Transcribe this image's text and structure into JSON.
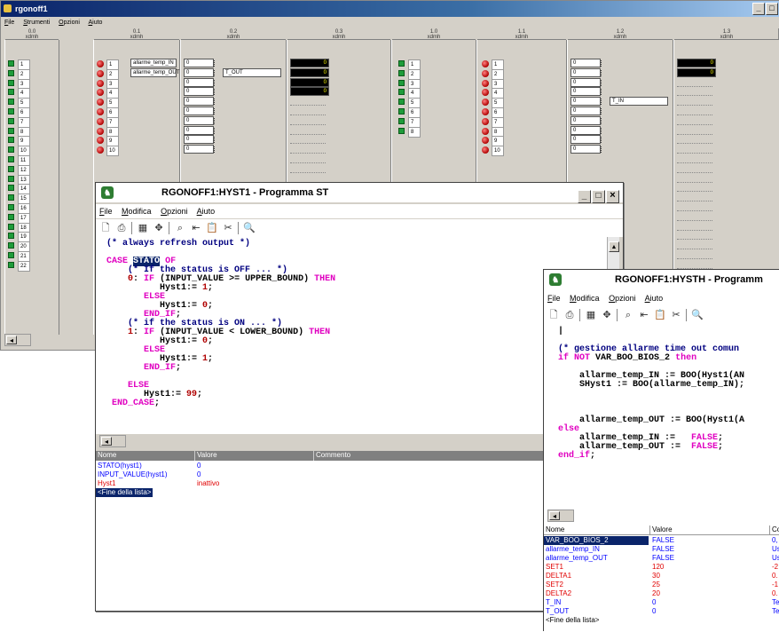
{
  "main": {
    "title": "rgonoff1",
    "menu": [
      {
        "label": "File",
        "u": "F",
        "rest": "ile"
      },
      {
        "label": "Strumenti",
        "u": "S",
        "rest": "trumenti"
      },
      {
        "label": "Opzioni",
        "u": "O",
        "rest": "pzioni"
      },
      {
        "label": "Aiuto",
        "u": "A",
        "rest": "iuto"
      }
    ],
    "modules": [
      {
        "num": "0.0",
        "kind": "xdmh"
      },
      {
        "num": "0.1",
        "kind": "xdmh"
      },
      {
        "num": "0.2",
        "kind": "xdmh"
      },
      {
        "num": "0.3",
        "kind": "xdmh"
      },
      {
        "num": "1.0",
        "kind": "xdmh"
      },
      {
        "num": "1.1",
        "kind": "xdmh"
      },
      {
        "num": "1.2",
        "kind": "xdmh"
      },
      {
        "num": "1.3",
        "kind": "xdmh"
      }
    ],
    "ch22": [
      "1",
      "2",
      "3",
      "4",
      "5",
      "6",
      "7",
      "8",
      "9",
      "10",
      "11",
      "12",
      "13",
      "14",
      "15",
      "16",
      "17",
      "18",
      "19",
      "20",
      "21",
      "22"
    ],
    "ch10": [
      "1",
      "2",
      "3",
      "4",
      "5",
      "6",
      "7",
      "8",
      "9",
      "10"
    ],
    "ch8": [
      "1",
      "2",
      "3",
      "4",
      "5",
      "6",
      "7",
      "8"
    ],
    "names_01": [
      "allarme_temp_IN",
      "allarme_temp_OUT"
    ],
    "vals_02": [
      "0",
      "0",
      "0",
      "0",
      "0",
      "0",
      "0",
      "0",
      "0",
      "0"
    ],
    "label_tout": "T_OUT",
    "vals_03": [
      "0",
      "0",
      "0",
      "0"
    ],
    "vals_12": [
      "0",
      "0",
      "0",
      "0",
      "0",
      "0",
      "0",
      "0",
      "0",
      "0"
    ],
    "label_tin": "T_IN",
    "vals_13": [
      "0",
      "0"
    ],
    "controls": {
      "minimize": "_",
      "maximize": "□"
    }
  },
  "hyst1": {
    "title": "RGONOFF1:HYST1 - Programma ST",
    "menu": [
      {
        "u": "F",
        "rest": "ile"
      },
      {
        "u": "M",
        "rest": "odifica"
      },
      {
        "u": "O",
        "rest": "pzioni"
      },
      {
        "u": "A",
        "rest": "iuto"
      }
    ],
    "controls": {
      "minimize": "_",
      "maximize": "□",
      "close": "×"
    },
    "code_line0": "(* always refresh output *)",
    "grid_headers": [
      "Nome",
      "Valore",
      "Commento"
    ],
    "grid_rows": [
      {
        "name": "STATO(hyst1)",
        "value": "0",
        "color": "blue"
      },
      {
        "name": "INPUT_VALUE(hyst1)",
        "value": "0",
        "color": "blue"
      },
      {
        "name": "Hyst1",
        "value": "inattivo",
        "color": "red"
      }
    ],
    "end_of_list": "<Fine della lista>"
  },
  "hysth": {
    "title": "RGONOFF1:HYSTH - Programm",
    "menu": [
      {
        "u": "F",
        "rest": "ile"
      },
      {
        "u": "M",
        "rest": "odifica"
      },
      {
        "u": "O",
        "rest": "pzioni"
      },
      {
        "u": "A",
        "rest": "iuto"
      }
    ],
    "grid_headers": [
      "Nome",
      "Valore",
      "Co"
    ],
    "grid_rows": [
      {
        "name": "VAR_BOO_BIOS_2",
        "value": "FALSE",
        "comment": "0,",
        "color": "blue",
        "selected": true
      },
      {
        "name": "allarme_temp_IN",
        "value": "FALSE",
        "comment": "Us",
        "color": "blue"
      },
      {
        "name": "allarme_temp_OUT",
        "value": "FALSE",
        "comment": "Us",
        "color": "blue"
      },
      {
        "name": "SET1",
        "value": "120",
        "comment": "-2",
        "color": "red"
      },
      {
        "name": "DELTA1",
        "value": "30",
        "comment": "0.",
        "color": "red"
      },
      {
        "name": "SET2",
        "value": "25",
        "comment": "-1",
        "color": "red"
      },
      {
        "name": "DELTA2",
        "value": "20",
        "comment": "0.",
        "color": "red"
      },
      {
        "name": "T_IN",
        "value": "0",
        "comment": "Te",
        "color": "blue"
      },
      {
        "name": "T_OUT",
        "value": "0",
        "comment": "Te",
        "color": "blue"
      }
    ],
    "end_of_list": "<Fine della lista>"
  }
}
